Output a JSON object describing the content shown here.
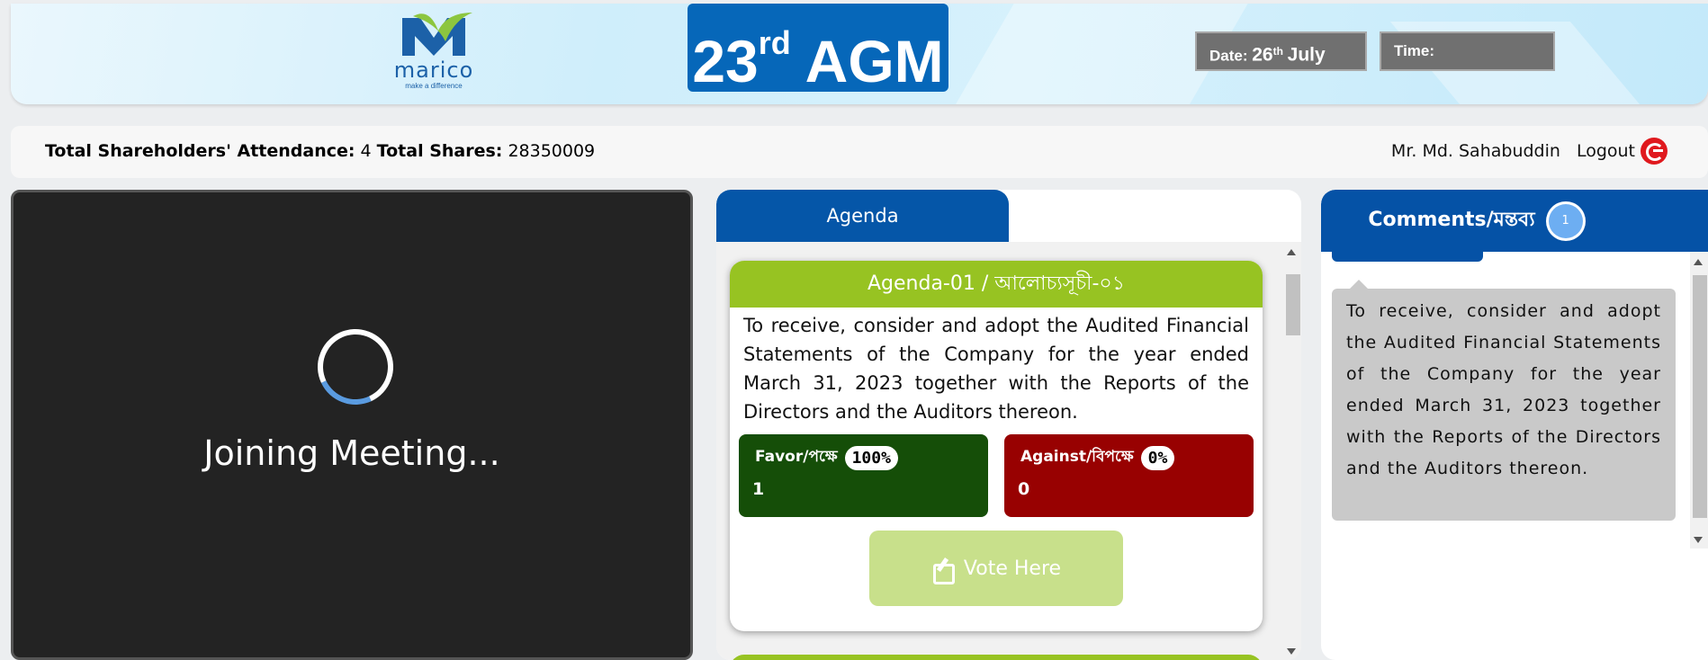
{
  "header": {
    "logo": {
      "brand": "marico",
      "tagline": "make a difference"
    },
    "event": {
      "number": "23",
      "suffix": "rd",
      "label": "AGM"
    },
    "date": {
      "prefix": "Date:",
      "day": "26",
      "suffix": "th",
      "month": "July"
    },
    "time": {
      "label": "Time:",
      "value": ""
    }
  },
  "statusbar": {
    "attendance_label": "Total Shareholders' Attendance:",
    "attendance_value": "4",
    "shares_label": "Total Shares:",
    "shares_value": "28350009",
    "user_name": "Mr. Md. Sahabuddin",
    "logout_label": "Logout"
  },
  "video": {
    "status": "Joining Meeting..."
  },
  "agenda": {
    "tab_label": "Agenda",
    "items": [
      {
        "title": "Agenda-01 / আলোচ্যসূচী-০১",
        "text": "To receive, consider and adopt the Audited Financial Statements of the Company for the year ended March 31, 2023 together with the Reports of the Directors and the Auditors thereon.",
        "favor": {
          "label": "Favor/পক্ষে",
          "percent": "100%",
          "count": "1"
        },
        "against": {
          "label": "Against/বিপক্ষে",
          "percent": "0%",
          "count": "0"
        },
        "vote_button": "Vote Here"
      }
    ]
  },
  "comments": {
    "title": "Comments/মন্তব্য",
    "count": "1",
    "items": [
      {
        "text": "To receive, consider and adopt the Audited Financial Statements of the Company for the year ended March 31, 2023 together with the Reports of the Directors and the Auditors thereon."
      }
    ]
  },
  "colors": {
    "primary_blue": "#0556a8",
    "agenda_green": "#97c322",
    "favor_green": "#154e08",
    "against_red": "#980101",
    "vote_button": "#c8e08b",
    "logout_red": "#e0191e"
  }
}
